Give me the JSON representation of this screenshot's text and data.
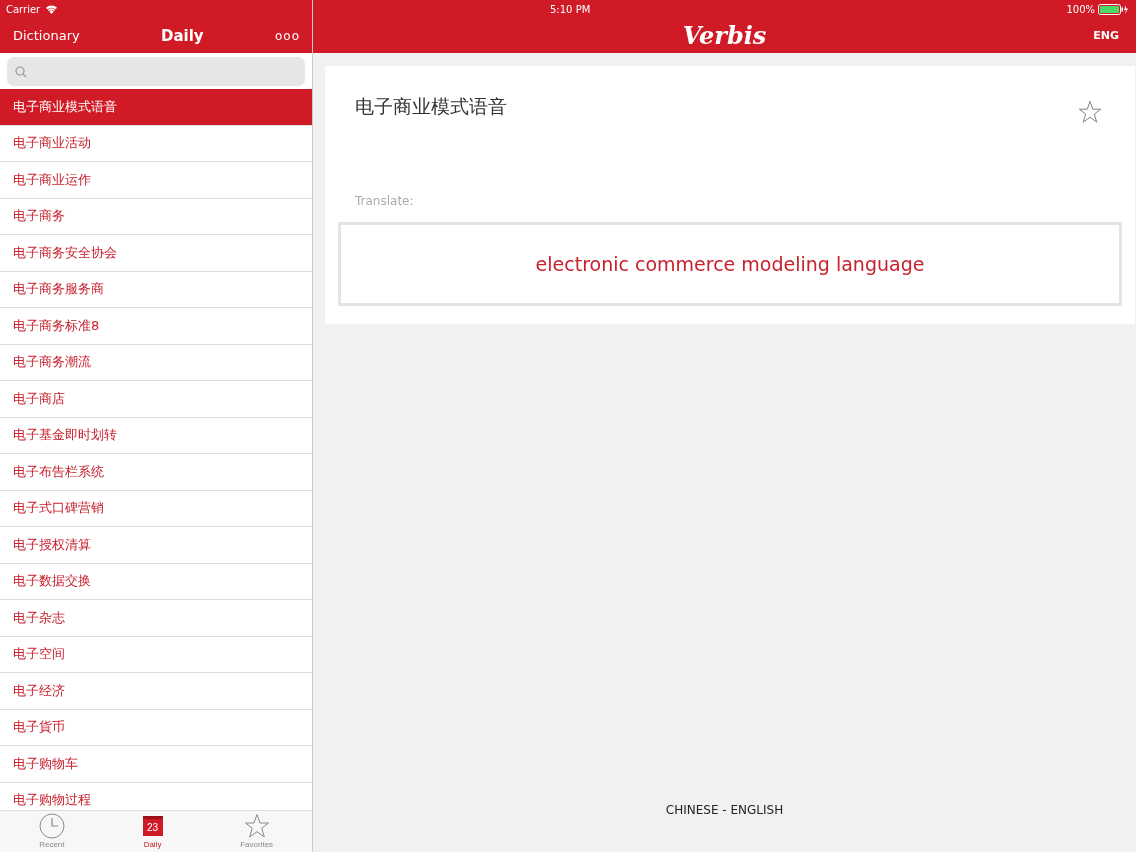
{
  "status_bar": {
    "carrier": "Carrier",
    "time": "5:10 PM",
    "battery": "100%"
  },
  "sidebar": {
    "nav_left": "Dictionary",
    "title": "Daily",
    "more": "ooo",
    "items": [
      {
        "label": "电子商业模式语音",
        "selected": true
      },
      {
        "label": "电子商业活动",
        "selected": false
      },
      {
        "label": "电子商业运作",
        "selected": false
      },
      {
        "label": "电子商务",
        "selected": false
      },
      {
        "label": "电子商务安全协会",
        "selected": false
      },
      {
        "label": "电子商务服务商",
        "selected": false
      },
      {
        "label": "电子商务标准8",
        "selected": false
      },
      {
        "label": "电子商务潮流",
        "selected": false
      },
      {
        "label": "电子商店",
        "selected": false
      },
      {
        "label": "电子基金即时划转",
        "selected": false
      },
      {
        "label": "电子布告栏系统",
        "selected": false
      },
      {
        "label": "电子式口碑营销",
        "selected": false
      },
      {
        "label": "电子授权清算",
        "selected": false
      },
      {
        "label": "电子数据交换",
        "selected": false
      },
      {
        "label": "电子杂志",
        "selected": false
      },
      {
        "label": "电子空间",
        "selected": false
      },
      {
        "label": "电子经济",
        "selected": false
      },
      {
        "label": "电子貨币",
        "selected": false
      },
      {
        "label": "电子购物车",
        "selected": false
      },
      {
        "label": "电子购物过程",
        "selected": false
      }
    ],
    "tabs": [
      {
        "kind": "clock",
        "label": "Recent",
        "selected": false
      },
      {
        "kind": "calendar",
        "label": "Daily",
        "day": "23",
        "selected": true
      },
      {
        "kind": "star",
        "label": "Favorites",
        "selected": false
      }
    ]
  },
  "header": {
    "logo": "Verbis",
    "language": "ENG"
  },
  "card": {
    "term": "电子商业模式语音",
    "favorite": false,
    "translate_label": "Translate:",
    "translation": "electronic commerce modeling language"
  },
  "footer": {
    "language_pair": "CHINESE - ENGLISH"
  }
}
